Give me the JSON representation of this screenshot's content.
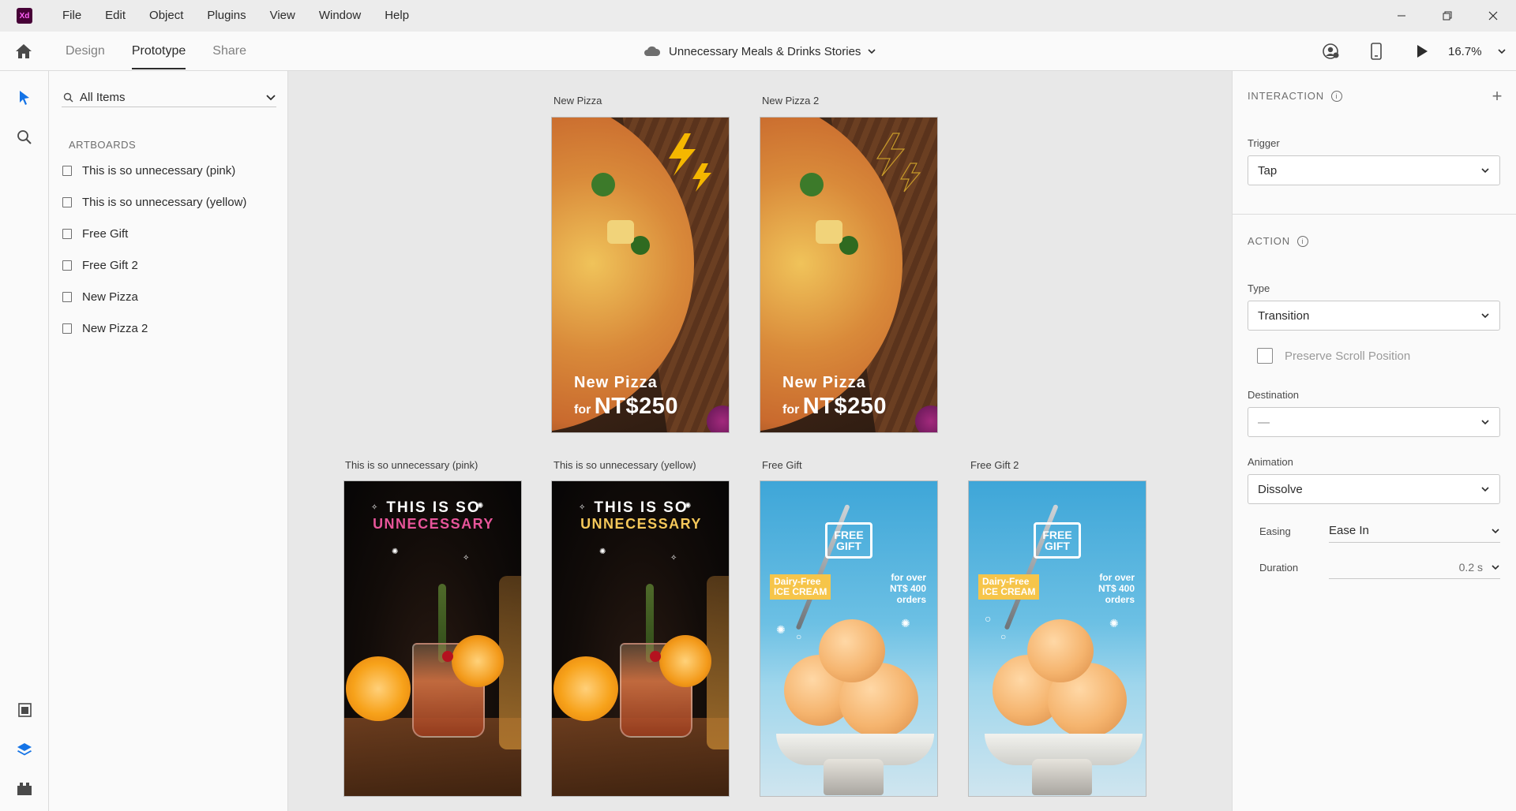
{
  "app": {
    "logo_text": "Xd",
    "menu": [
      "File",
      "Edit",
      "Object",
      "Plugins",
      "View",
      "Window",
      "Help"
    ]
  },
  "toolbar": {
    "tabs": [
      "Design",
      "Prototype",
      "Share"
    ],
    "active_tab": "Prototype",
    "document_title": "Unnecessary Meals & Drinks Stories",
    "zoom": "16.7%"
  },
  "layers_panel": {
    "filter_label": "All Items",
    "section_title": "ARTBOARDS",
    "artboards": [
      "This is so unnecessary (pink)",
      "This is so unnecessary (yellow)",
      "Free Gift",
      "Free Gift 2",
      "New Pizza",
      "New Pizza 2"
    ]
  },
  "canvas": {
    "artboards": [
      {
        "name": "New Pizza"
      },
      {
        "name": "New Pizza 2"
      },
      {
        "name": "This is so unnecessary (pink)"
      },
      {
        "name": "This is so unnecessary (yellow)"
      },
      {
        "name": "Free Gift"
      },
      {
        "name": "Free Gift 2"
      }
    ],
    "pizza_copy": {
      "line1": "New Pizza",
      "for": "for",
      "price": "NT$250"
    },
    "cocktail_copy": {
      "line1": "THIS IS SO",
      "line2": "UNNECESSARY"
    },
    "cocktail_colors": {
      "pink": "#e8559a",
      "yellow": "#f5c85a"
    },
    "icecream_copy": {
      "badge": "FREE\nGIFT",
      "tag_line1": "Dairy-Free",
      "tag_line2": "ICE CREAM",
      "offer_line1": "for over",
      "offer_line2": "NT$ 400",
      "offer_line3": "orders"
    }
  },
  "inspector": {
    "interaction_title": "INTERACTION",
    "trigger_label": "Trigger",
    "trigger_value": "Tap",
    "action_title": "ACTION",
    "type_label": "Type",
    "type_value": "Transition",
    "preserve_scroll_label": "Preserve Scroll Position",
    "preserve_scroll_checked": false,
    "destination_label": "Destination",
    "destination_value": "—",
    "animation_label": "Animation",
    "animation_value": "Dissolve",
    "easing_label": "Easing",
    "easing_value": "Ease In",
    "duration_label": "Duration",
    "duration_value": "0.2 s"
  },
  "colors": {
    "accent": "#1473e6",
    "xd_logo_bg": "#470137",
    "xd_logo_fg": "#ff61f6"
  }
}
